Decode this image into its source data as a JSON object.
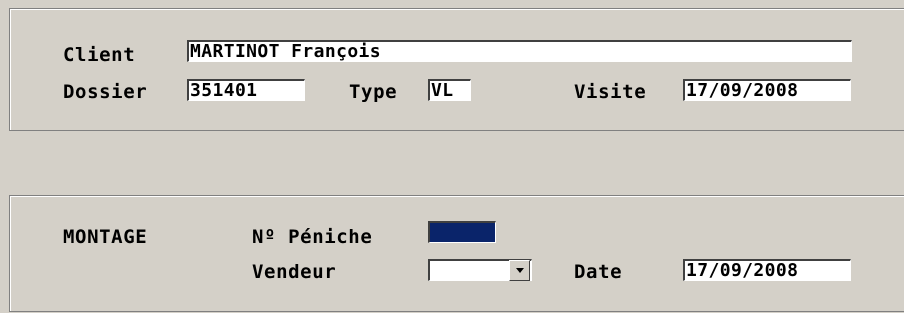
{
  "header": {
    "client_label": "Client",
    "client_value": "MARTINOT François",
    "dossier_label": "Dossier",
    "dossier_value": "351401",
    "type_label": "Type",
    "type_value": "VL",
    "visite_label": "Visite",
    "visite_value": "17/09/2008"
  },
  "montage": {
    "section_label": "MONTAGE",
    "peniche_label": "Nº Péniche",
    "peniche_value": "",
    "vendeur_label": "Vendeur",
    "vendeur_value": "",
    "date_label": "Date",
    "date_value": "17/09/2008"
  },
  "colors": {
    "background": "#d4d0c8",
    "field_bg": "#ffffff",
    "selected_field_bg": "#0a246a"
  },
  "icons": {
    "dropdown": "chevron-down-icon"
  }
}
